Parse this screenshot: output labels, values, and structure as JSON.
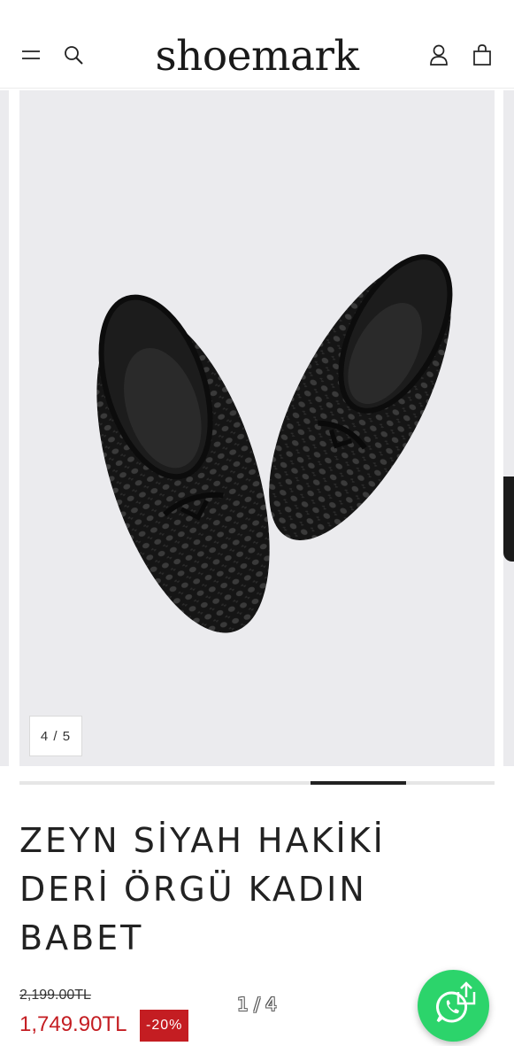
{
  "header": {
    "logo": "shoemark",
    "icons": [
      "menu-icon",
      "search-icon",
      "user-icon",
      "shopping-bag-icon"
    ]
  },
  "gallery": {
    "counter": "4 / 5",
    "current_slide": 4,
    "total_slides": 5,
    "progress_fraction": 0.2,
    "progress_segment_index": 3
  },
  "product": {
    "title": "ZEYN SİYAH HAKİKİ DERİ ÖRGÜ KADIN BABET",
    "old_price": "2,199.00TL",
    "new_price": "1,749.90TL",
    "discount": "-20%",
    "image_index": "1 / 4"
  },
  "colors": {
    "accent_red": "#c41d22",
    "whatsapp_green": "#2cd46b",
    "image_bg": "#ebebee"
  },
  "whatsapp": {
    "icons": [
      "whatsapp-icon",
      "share-icon"
    ]
  }
}
